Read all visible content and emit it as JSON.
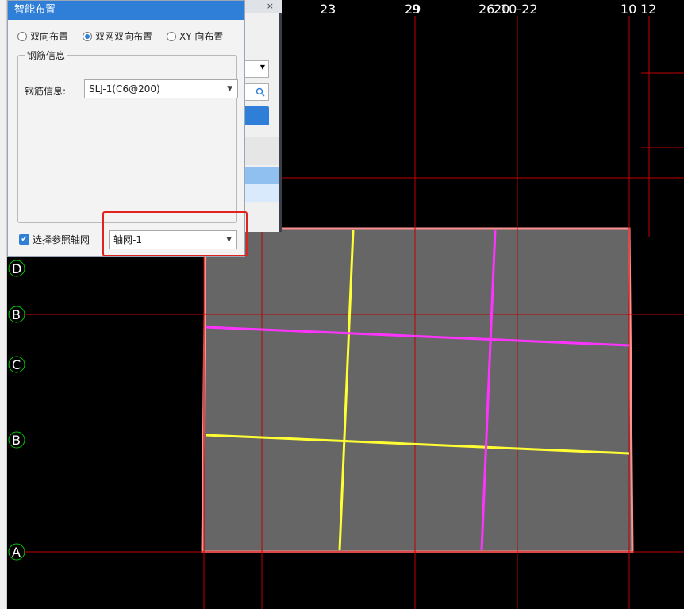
{
  "dialog": {
    "title": "智能布置",
    "radios": [
      {
        "label": "双向布置",
        "selected": false
      },
      {
        "label": "双网双向布置",
        "selected": true
      },
      {
        "label": "XY 向布置",
        "selected": false
      }
    ],
    "group_title": "钢筋信息",
    "rebar_label": "钢筋信息:",
    "rebar_value": "SLJ-1(C6@200)",
    "use_axis_checkbox": {
      "label": "选择参照轴网",
      "checked": true
    },
    "axis_value": "轴网-1"
  },
  "background_panel": {
    "close_icon": "×",
    "search_icon": "search-icon"
  },
  "canvas": {
    "top_axis_labels": [
      "23",
      "29",
      "9",
      "26",
      "20",
      "10-22",
      "10",
      "12"
    ],
    "left_axis_labels": [
      "D",
      "B",
      "C",
      "B",
      "A"
    ],
    "colors": {
      "background": "#000000",
      "slab_fill": "#666666",
      "slab_edge": "#ff9090",
      "grid": "#c00000",
      "rebar_yellow": "#ffff33",
      "rebar_magenta": "#ff33ff",
      "axis_bubble": "#00c800",
      "dialog_accent": "#2f7fd8",
      "highlight": "#e0231d"
    }
  }
}
